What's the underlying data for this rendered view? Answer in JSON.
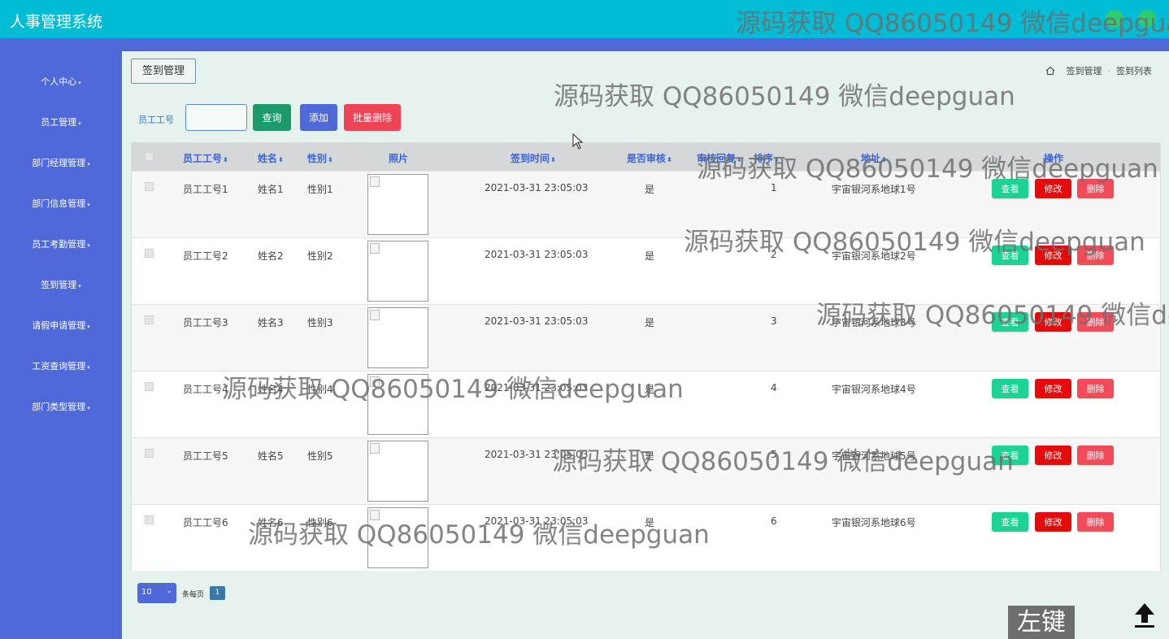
{
  "app_title": "人事管理系统",
  "sidebar": {
    "items": [
      {
        "label": "个人中心"
      },
      {
        "label": "员工管理"
      },
      {
        "label": "部门经理管理"
      },
      {
        "label": "部门信息管理"
      },
      {
        "label": "员工考勤管理"
      },
      {
        "label": "签到管理"
      },
      {
        "label": "请假申请管理"
      },
      {
        "label": "工资查询管理"
      },
      {
        "label": "部门类型管理"
      }
    ]
  },
  "page_button": "签到管理",
  "breadcrumb": {
    "items": [
      "签到管理",
      "签到列表"
    ]
  },
  "search": {
    "label": "员工工号",
    "value": ""
  },
  "buttons": {
    "query": "查询",
    "add": "添加",
    "batch_delete": "批量删除"
  },
  "table": {
    "columns": [
      "员工工号",
      "姓名",
      "性别",
      "照片",
      "签到时间",
      "是否审核",
      "审核回复",
      "排序",
      "地址",
      "操作"
    ],
    "rows": [
      {
        "id": "员工工号1",
        "name": "姓名1",
        "gender": "性别1",
        "time": "2021-03-31 23:05:03",
        "reviewed": "是",
        "order": "1",
        "address": "宇宙银河系地球1号"
      },
      {
        "id": "员工工号2",
        "name": "姓名2",
        "gender": "性别2",
        "time": "2021-03-31 23:05:03",
        "reviewed": "是",
        "order": "2",
        "address": "宇宙银河系地球2号"
      },
      {
        "id": "员工工号3",
        "name": "姓名3",
        "gender": "性别3",
        "time": "2021-03-31 23:05:03",
        "reviewed": "是",
        "order": "3",
        "address": "宇宙银河系地球3号"
      },
      {
        "id": "员工工号4",
        "name": "姓名4",
        "gender": "性别4",
        "time": "2021-03-31 23:05:03",
        "reviewed": "是",
        "order": "4",
        "address": "宇宙银河系地球4号"
      },
      {
        "id": "员工工号5",
        "name": "姓名5",
        "gender": "性别5",
        "time": "2021-03-31 23:05:03",
        "reviewed": "是",
        "order": "5",
        "address": "宇宙银河系地球5号"
      },
      {
        "id": "员工工号6",
        "name": "姓名6",
        "gender": "性别6",
        "time": "2021-03-31 23:05:03",
        "reviewed": "是",
        "order": "6",
        "address": "宇宙银河系地球6号"
      }
    ],
    "actions": {
      "view": "查看",
      "edit": "修改",
      "delete": "删除"
    }
  },
  "pagination": {
    "page_size": "10",
    "per_page_label": "条每页",
    "current_page": "1"
  },
  "watermark_text": "源码获取 QQ86050149 微信deepguan",
  "overlay_key": "左键",
  "icons": {
    "home": "home-icon",
    "back_to_top": "upload-arrow-icon",
    "cursor": "mouse-cursor-icon"
  },
  "colors": {
    "topbar": "#00bcd4",
    "sidebar": "#4f6ad8",
    "query": "#1d9a6c",
    "add": "#4f6ad8",
    "batch_delete": "#ee4456",
    "view": "#1bd394",
    "edit": "#e60a0a",
    "delete": "#f14a59"
  }
}
